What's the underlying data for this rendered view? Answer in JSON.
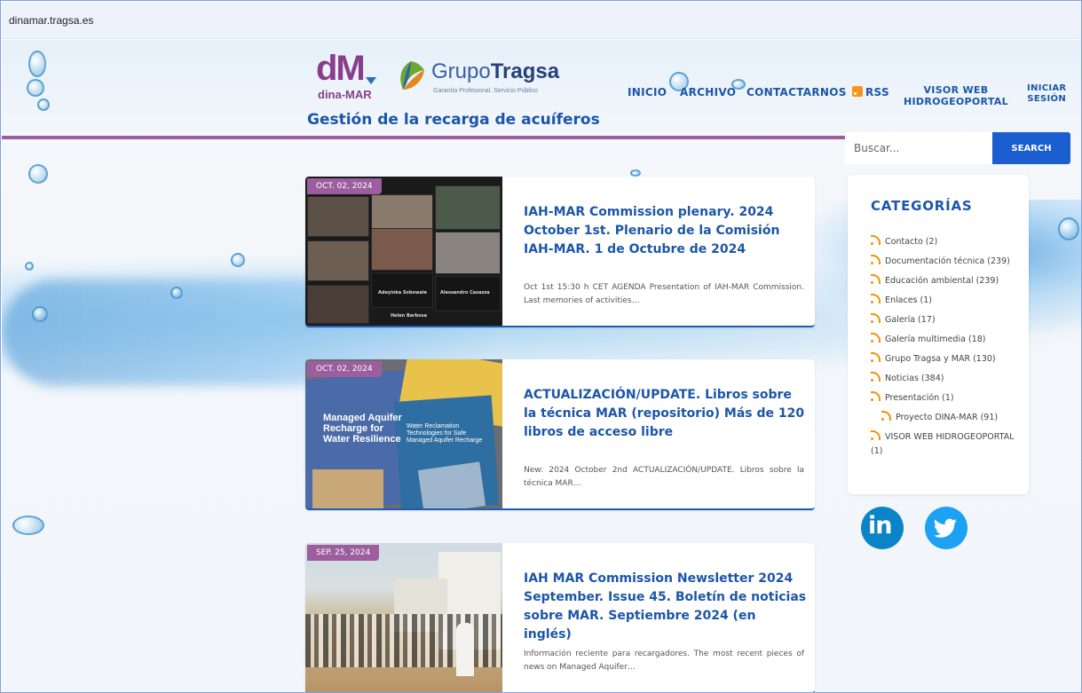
{
  "browser": {
    "url": "dinamar.tragsa.es"
  },
  "header": {
    "logo_dm_text": "dM",
    "logo_dm_sub": "dina-MAR",
    "logo_tragsa_light": "Grupo",
    "logo_tragsa_bold": "Tragsa",
    "logo_tragsa_tag": "Garantía Profesional. Servicio Público",
    "site_title": "Gestión de la recarga de acuíferos"
  },
  "nav": {
    "inicio": "INICIO",
    "archivo": "ARCHIVO",
    "contactarnos": "CONTACTARNOS",
    "rss": "RSS",
    "visor_line1": "VISOR WEB",
    "visor_line2": "HIDROGEOPORTAL",
    "iniciar_line1": "INICIAR",
    "iniciar_line2": "SESIÓN"
  },
  "search": {
    "placeholder": "Buscar...",
    "button": "SEARCH"
  },
  "posts": [
    {
      "date": "OCT. 02, 2024",
      "title": "IAH-MAR Commission plenary. 2024 October 1st. Plenario de la Comisión IAH-MAR. 1 de Octubre de 2024",
      "excerpt": "Oct 1st 15:30 h CET AGENDA Presentation of IAH-MAR Commission. Last memories of activities…",
      "thumb_labels": [
        "Adeyinka Sobowale",
        "Alessandro Casazza",
        "Helen Barbosa"
      ]
    },
    {
      "date": "OCT. 02, 2024",
      "title": "ACTUALIZACIÓN/UPDATE. Libros sobre la técnica MAR (repositorio) Más de 120 libros de acceso libre",
      "excerpt": "New: 2024 October 2nd ACTUALIZACIÓN/UPDATE. Libros sobre la técnica MAR…",
      "thumb_labels": [
        "Managed Aquifer Recharge for Water Resilience",
        "Water Reclamation Technologies for Safe Managed Aquifer Recharge"
      ]
    },
    {
      "date": "SEP. 25, 2024",
      "title": "IAH MAR Commission Newsletter 2024 September. Issue 45. Boletín de noticias sobre MAR. Septiembre 2024 (en inglés)",
      "excerpt": "Información reciente para recargadores. The most recent pieces of news on Managed Aquifer…"
    }
  ],
  "sidebar": {
    "title": "CATEGORÍAS",
    "categories": [
      "Contacto (2)",
      "Documentación técnica (239)",
      "Educación ambiental (239)",
      "Enlaces (1)",
      "Galería (17)",
      "Galería multimedia (18)",
      "Grupo Tragsa y MAR (130)",
      "Noticias (384)",
      "Presentación (1)",
      "Proyecto DINA-MAR (91)",
      "VISOR WEB HIDROGEOPORTAL (1)"
    ],
    "social": [
      "linkedin-icon",
      "twitter-icon"
    ],
    "linkedin_text": "in"
  },
  "colors": {
    "accent": "#1c56a8",
    "purple": "#9c5e9e",
    "search_button": "#1b5ecf",
    "rss": "#f39200"
  }
}
